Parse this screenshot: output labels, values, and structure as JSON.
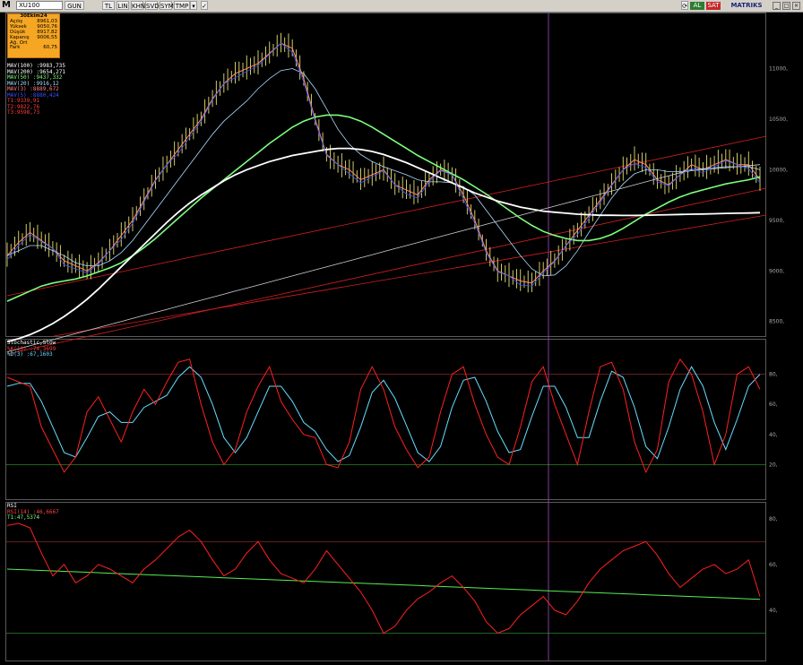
{
  "toolbar": {
    "logo": "M",
    "symbol": "XU100",
    "buttons": [
      "GUN",
      "TL",
      "LIN",
      "KHN",
      "SVD",
      "SYM",
      "TMP"
    ],
    "al_label": "AL",
    "sat_label": "SAT",
    "brand": "MATRIKS"
  },
  "infobox": {
    "date": "30Ekim24",
    "rows": [
      {
        "label": "Açılış",
        "value": "8961,03"
      },
      {
        "label": "Yüksek",
        "value": "9050,76"
      },
      {
        "label": "Düşük",
        "value": "8917,82"
      },
      {
        "label": "Kapanış",
        "value": "9006,55"
      },
      {
        "label": "Ağ. Ort",
        "value": ""
      },
      {
        "label": "Fark",
        "value": "60,75"
      }
    ]
  },
  "price_legend": [
    {
      "text": "MAV(100)    :9983,735",
      "color": "#ffffff"
    },
    {
      "text": "MAV(200)    :9654,271",
      "color": "#ffffff"
    },
    {
      "text": "MAV(50)     :9437,332",
      "color": "#7dff7d"
    },
    {
      "text": "MAV(20)     :9916,12",
      "color": "#aaddff"
    },
    {
      "text": "MAV(3)      :8889,672",
      "color": "#ff8080"
    },
    {
      "text": "MAV(5)      :8880,424",
      "color": "#3355ff"
    },
    {
      "text": "T1:9339,91",
      "color": "#ff4040"
    },
    {
      "text": "T2:9822,76",
      "color": "#ff4040"
    },
    {
      "text": "T3:9598,73",
      "color": "#ff4040"
    }
  ],
  "stoch_legend": [
    {
      "text": "Stochastic,Slow",
      "color": "#ffffff"
    },
    {
      "text": "%K(10)      :74,3699",
      "color": "#ff4040"
    },
    {
      "text": "%D(3)       :67,1603",
      "color": "#66ddff"
    }
  ],
  "rsi_legend": [
    {
      "text": "RSI",
      "color": "#ffffff"
    },
    {
      "text": "RSI(14)     :46,6667",
      "color": "#ff4040"
    },
    {
      "text": "T1:47,5374",
      "color": "#7dff7d"
    }
  ],
  "colors": {
    "price_candle": "#e8e070",
    "mav3": "#ff8c69",
    "mav5": "#3355ff",
    "mav20": "#aaddff",
    "mav50": "#7dff7d",
    "mav100": "#ffffff",
    "mav200": "#cfcfcf",
    "trend": "#d42020",
    "stoch_k": "#ff2020",
    "stoch_d": "#66ddff",
    "rsi": "#ff2020",
    "rsi_trend": "#55ee55"
  },
  "chart_data": [
    {
      "type": "line",
      "panel": "price",
      "yticks": [
        8500,
        9000,
        9500,
        10000,
        10500,
        11000
      ],
      "ylim": [
        8400,
        11500
      ],
      "grid": false,
      "series": [
        {
          "name": "MAV(3)",
          "values": [
            9150,
            9280,
            9380,
            9300,
            9220,
            9100,
            9050,
            9000,
            9080,
            9200,
            9350,
            9500,
            9700,
            9900,
            10050,
            10200,
            10350,
            10500,
            10700,
            10850,
            10950,
            11000,
            11050,
            11150,
            11250,
            11200,
            10900,
            10500,
            10150,
            10050,
            10000,
            9900,
            9950,
            10000,
            9850,
            9800,
            9750,
            9900,
            10000,
            9950,
            9750,
            9500,
            9200,
            9000,
            8950,
            8900,
            8880,
            9000,
            9100,
            9250,
            9400,
            9550,
            9700,
            9850,
            10000,
            10100,
            10050,
            9900,
            9850,
            9950,
            10050,
            10000,
            10050,
            10100,
            10050,
            10050,
            9900
          ]
        },
        {
          "name": "MAV(20)",
          "values": [
            9150,
            9200,
            9250,
            9250,
            9200,
            9150,
            9080,
            9050,
            9050,
            9100,
            9180,
            9300,
            9450,
            9600,
            9750,
            9900,
            10050,
            10200,
            10350,
            10480,
            10580,
            10680,
            10800,
            10900,
            10980,
            11000,
            10950,
            10800,
            10600,
            10400,
            10250,
            10150,
            10080,
            10030,
            9990,
            9950,
            9900,
            9880,
            9880,
            9870,
            9830,
            9750,
            9600,
            9450,
            9300,
            9150,
            9020,
            8950,
            8960,
            9050,
            9200,
            9380,
            9550,
            9720,
            9860,
            9960,
            10000,
            10000,
            9980,
            9980,
            10000,
            10010,
            10020,
            10030,
            10030,
            10030,
            10000
          ]
        },
        {
          "name": "MAV(50)",
          "values": [
            8700,
            8750,
            8800,
            8850,
            8880,
            8900,
            8920,
            8950,
            8990,
            9030,
            9080,
            9150,
            9230,
            9320,
            9420,
            9520,
            9620,
            9720,
            9810,
            9900,
            9990,
            10080,
            10170,
            10260,
            10340,
            10420,
            10480,
            10520,
            10540,
            10540,
            10520,
            10480,
            10420,
            10350,
            10280,
            10210,
            10140,
            10080,
            10020,
            9960,
            9900,
            9830,
            9760,
            9680,
            9600,
            9520,
            9450,
            9390,
            9350,
            9320,
            9300,
            9300,
            9320,
            9360,
            9420,
            9490,
            9560,
            9620,
            9680,
            9730,
            9770,
            9800,
            9830,
            9860,
            9880,
            9900,
            9930
          ]
        },
        {
          "name": "MAV(100)",
          "values": [
            8300,
            8330,
            8370,
            8420,
            8480,
            8550,
            8630,
            8720,
            8820,
            8930,
            9040,
            9150,
            9260,
            9370,
            9480,
            9580,
            9670,
            9750,
            9820,
            9890,
            9950,
            10000,
            10040,
            10080,
            10110,
            10140,
            10160,
            10180,
            10200,
            10210,
            10210,
            10200,
            10180,
            10150,
            10110,
            10070,
            10020,
            9970,
            9920,
            9870,
            9820,
            9770,
            9730,
            9690,
            9660,
            9630,
            9610,
            9590,
            9580,
            9570,
            9560,
            9555,
            9550,
            9550,
            9548,
            9548,
            9550,
            9552,
            9555,
            9558,
            9560,
            9562,
            9565,
            9568,
            9570,
            9572,
            9575
          ]
        },
        {
          "name": "MAV(200)",
          "values": [
            8200,
            8230,
            8260,
            8290,
            8320,
            8350,
            8380,
            8410,
            8440,
            8470,
            8500,
            8530,
            8560,
            8590,
            8620,
            8650,
            8680,
            8710,
            8740,
            8770,
            8800,
            8830,
            8860,
            8890,
            8920,
            8950,
            8980,
            9010,
            9040,
            9070,
            9100,
            9130,
            9160,
            9190,
            9220,
            9250,
            9280,
            9310,
            9340,
            9370,
            9400,
            9430,
            9460,
            9490,
            9520,
            9550,
            9580,
            9610,
            9640,
            9670,
            9700,
            9730,
            9760,
            9790,
            9820,
            9850,
            9880,
            9910,
            9940,
            9970,
            9990,
            10000,
            10010,
            10020,
            10030,
            10040,
            10050
          ]
        }
      ]
    },
    {
      "type": "line",
      "panel": "stochastic",
      "yticks": [
        20,
        40,
        60,
        80
      ],
      "ylim": [
        0,
        100
      ],
      "levels": [
        20,
        80
      ],
      "series": [
        {
          "name": "%K(10)",
          "values": [
            78,
            75,
            72,
            45,
            30,
            15,
            25,
            55,
            65,
            50,
            35,
            55,
            70,
            60,
            75,
            88,
            90,
            60,
            35,
            20,
            30,
            55,
            72,
            85,
            62,
            50,
            40,
            38,
            20,
            18,
            35,
            70,
            85,
            70,
            45,
            30,
            18,
            25,
            55,
            80,
            85,
            60,
            40,
            25,
            20,
            45,
            75,
            85,
            60,
            40,
            20,
            55,
            85,
            88,
            70,
            35,
            15,
            30,
            75,
            90,
            80,
            55,
            20,
            40,
            80,
            85,
            70
          ]
        },
        {
          "name": "%D(3)",
          "values": [
            72,
            74,
            74,
            62,
            45,
            28,
            25,
            38,
            52,
            55,
            48,
            48,
            58,
            62,
            66,
            78,
            85,
            78,
            60,
            38,
            28,
            38,
            55,
            72,
            72,
            62,
            48,
            42,
            30,
            22,
            26,
            45,
            68,
            76,
            64,
            46,
            28,
            22,
            32,
            58,
            76,
            78,
            62,
            42,
            28,
            30,
            52,
            72,
            72,
            58,
            38,
            38,
            62,
            82,
            78,
            58,
            32,
            24,
            45,
            70,
            85,
            72,
            48,
            30,
            50,
            72,
            80
          ]
        }
      ]
    },
    {
      "type": "line",
      "panel": "rsi",
      "yticks": [
        40,
        60,
        80
      ],
      "ylim": [
        20,
        85
      ],
      "levels": [
        30,
        70
      ],
      "series": [
        {
          "name": "RSI(14)",
          "values": [
            77,
            78,
            76,
            65,
            55,
            60,
            52,
            55,
            60,
            58,
            55,
            52,
            58,
            62,
            67,
            72,
            75,
            70,
            62,
            55,
            58,
            65,
            70,
            62,
            56,
            54,
            52,
            58,
            66,
            60,
            54,
            48,
            40,
            30,
            33,
            40,
            45,
            48,
            52,
            55,
            50,
            44,
            35,
            30,
            32,
            38,
            42,
            46,
            40,
            38,
            44,
            52,
            58,
            62,
            66,
            68,
            70,
            64,
            56,
            50,
            54,
            58,
            60,
            56,
            58,
            62,
            46
          ]
        },
        {
          "name": "T1",
          "values": [
            58,
            57.8,
            57.6,
            57.4,
            57.2,
            57.0,
            56.8,
            56.6,
            56.4,
            56.2,
            56.0,
            55.8,
            55.6,
            55.4,
            55.2,
            55.0,
            54.8,
            54.6,
            54.4,
            54.2,
            54.0,
            53.8,
            53.6,
            53.4,
            53.2,
            53.0,
            52.8,
            52.6,
            52.4,
            52.2,
            52.0,
            51.8,
            51.6,
            51.4,
            51.2,
            51.0,
            50.8,
            50.6,
            50.4,
            50.2,
            50.0,
            49.8,
            49.6,
            49.4,
            49.2,
            49.0,
            48.8,
            48.6,
            48.4,
            48.2,
            48.0,
            47.8,
            47.6,
            47.4,
            47.2,
            47.0,
            46.8,
            46.6,
            46.4,
            46.2,
            46.0,
            45.8,
            45.6,
            45.4,
            45.2,
            45.0,
            44.8
          ]
        }
      ]
    }
  ]
}
